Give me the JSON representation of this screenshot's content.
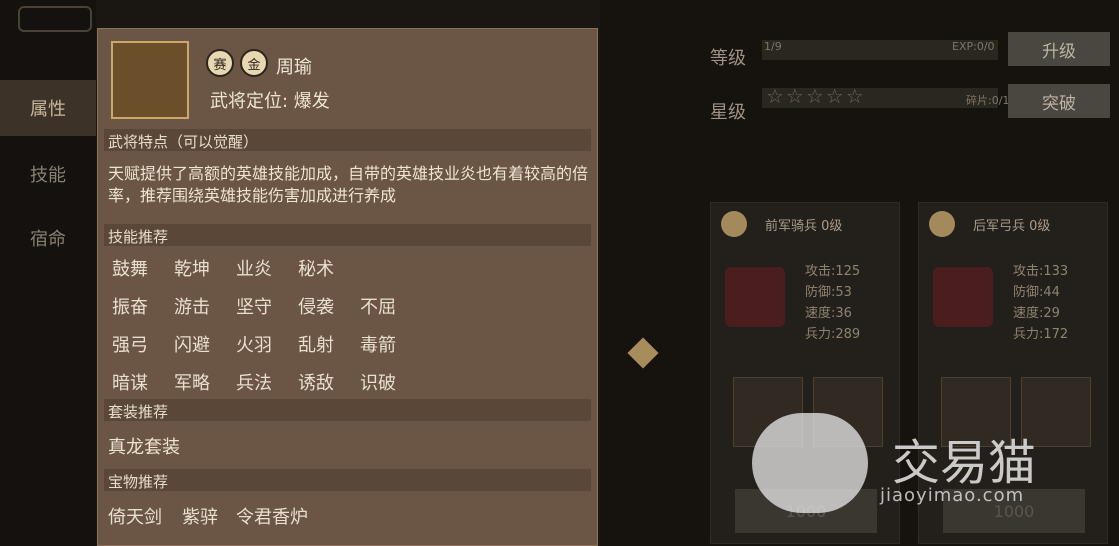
{
  "sidebar": {
    "items": [
      {
        "label": "属性",
        "active": true
      },
      {
        "label": "技能",
        "active": false
      },
      {
        "label": "宿命",
        "active": false
      }
    ]
  },
  "main": {
    "level": {
      "label": "等级",
      "value": "1/9",
      "exp": "EXP:0/0",
      "button": "升级"
    },
    "star": {
      "label": "星级",
      "fragments": "碎片:0/10",
      "button": "突破",
      "stars_filled": 0,
      "stars_total": 5
    },
    "units": [
      {
        "title": "前军骑兵 0级",
        "stats": [
          "攻击:125",
          "防御:53",
          "速度:36",
          "兵力:289"
        ],
        "cost": "1000"
      },
      {
        "title": "后军弓兵 0级",
        "stats": [
          "攻击:133",
          "防御:44",
          "速度:29",
          "兵力:172"
        ],
        "cost": "1000"
      }
    ]
  },
  "hero_panel": {
    "name": "周瑜",
    "badge1": "赛",
    "badge2": "金",
    "role": "武将定位: 爆发",
    "feature_title": "武将特点（可以觉醒）",
    "feature_text": "天赋提供了高额的英雄技能加成，自带的英雄技业炎也有着较高的倍率，推荐围绕英雄技能伤害加成进行养成",
    "skills_title": "技能推荐",
    "skills": [
      [
        "鼓舞",
        "乾坤",
        "业炎",
        "秘术"
      ],
      [
        "振奋",
        "游击",
        "坚守",
        "侵袭",
        "不屈"
      ],
      [
        "强弓",
        "闪避",
        "火羽",
        "乱射",
        "毒箭"
      ],
      [
        "暗谋",
        "军略",
        "兵法",
        "诱敌",
        "识破"
      ]
    ],
    "suit_title": "套装推荐",
    "suit": "真龙套装",
    "treasure_title": "宝物推荐",
    "treasures": [
      "倚天剑",
      "紫骍",
      "令君香炉"
    ]
  },
  "watermark": {
    "brand": "交易猫",
    "url": "jiaoyimao.com"
  }
}
